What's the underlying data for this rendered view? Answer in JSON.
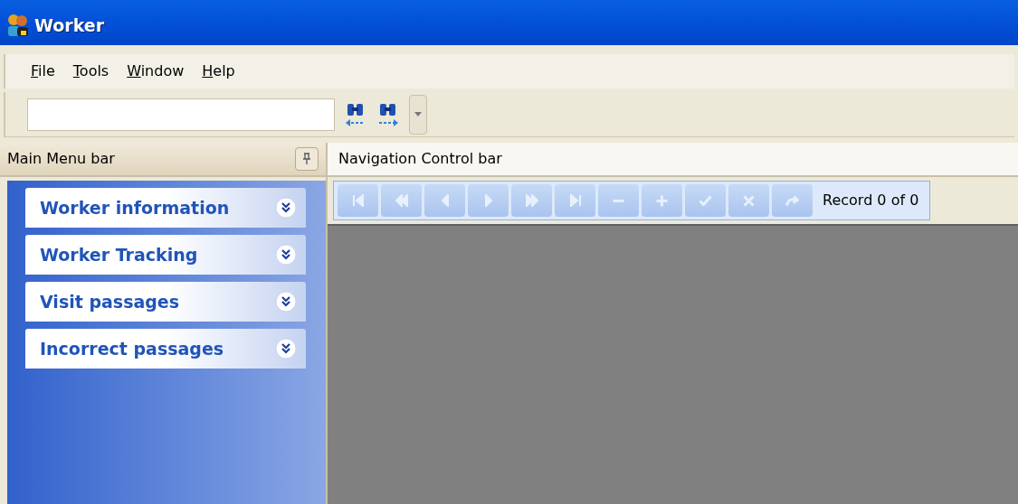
{
  "window": {
    "title": "Worker"
  },
  "menu": [
    "File",
    "Tools",
    "Window",
    "Help"
  ],
  "left_panel": {
    "title": "Main Menu bar",
    "groups": [
      {
        "label": "Worker information",
        "expanded": false
      },
      {
        "label": "Worker Tracking",
        "expanded": false
      },
      {
        "label": "Visit passages",
        "expanded": false
      },
      {
        "label": "Incorrect passages",
        "expanded": false
      }
    ]
  },
  "right_panel": {
    "title": "Navigation Control bar",
    "nav_buttons": [
      {
        "kind": "first",
        "disabled": true
      },
      {
        "kind": "prev-page",
        "disabled": true
      },
      {
        "kind": "prev",
        "disabled": true
      },
      {
        "kind": "next",
        "disabled": true
      },
      {
        "kind": "next-page",
        "disabled": true
      },
      {
        "kind": "last",
        "disabled": true
      },
      {
        "kind": "remove",
        "disabled": true
      },
      {
        "kind": "add",
        "disabled": true
      },
      {
        "kind": "apply",
        "disabled": true
      },
      {
        "kind": "cancel",
        "disabled": true
      },
      {
        "kind": "refresh",
        "disabled": true
      }
    ],
    "record": "Record 0 of 0"
  }
}
